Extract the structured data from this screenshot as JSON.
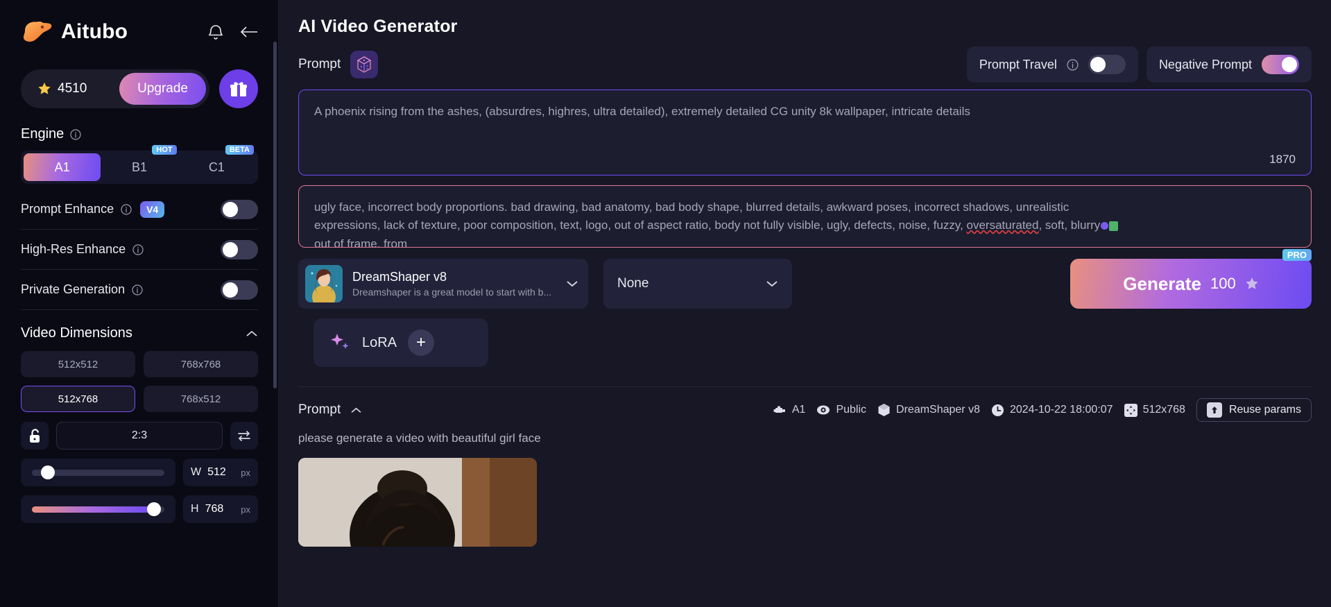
{
  "sidebar": {
    "brand": "Aitubo",
    "icons": {
      "bell": "bell-icon",
      "back": "back-arrow-icon",
      "gift": "gift-icon",
      "star": "star-icon"
    },
    "credits": "4510",
    "upgrade_label": "Upgrade",
    "engine": {
      "title": "Engine",
      "tabs": [
        {
          "label": "A1",
          "tag": "",
          "active": true
        },
        {
          "label": "B1",
          "tag": "HOT",
          "active": false
        },
        {
          "label": "C1",
          "tag": "BETA",
          "active": false
        }
      ]
    },
    "toggles": [
      {
        "label": "Prompt Enhance",
        "badge": "V4",
        "on": false
      },
      {
        "label": "High-Res Enhance",
        "badge": "",
        "on": false
      },
      {
        "label": "Private Generation",
        "badge": "",
        "on": false
      }
    ],
    "dimensions": {
      "title": "Video Dimensions",
      "presets": [
        {
          "label": "512x512",
          "active": false
        },
        {
          "label": "768x768",
          "active": false
        },
        {
          "label": "512x768",
          "active": true
        },
        {
          "label": "768x512",
          "active": false
        }
      ],
      "lock_icon": "unlock-icon",
      "ratio": "2:3",
      "swap_icon": "swap-icon",
      "width": {
        "key": "W",
        "value": "512",
        "unit": "px",
        "percent": 12
      },
      "height": {
        "key": "H",
        "value": "768",
        "unit": "px",
        "percent": 92
      }
    }
  },
  "main": {
    "title": "AI Video Generator",
    "prompt_label": "Prompt",
    "dice_icon": "dice-cube-icon",
    "header_toggles": [
      {
        "label": "Prompt Travel",
        "info": true,
        "on": false
      },
      {
        "label": "Negative Prompt",
        "info": false,
        "on": true
      }
    ],
    "prompt": {
      "value": "A phoenix rising from the ashes, (absurdres, highres, ultra detailed), extremely detailed CG unity 8k wallpaper, intricate details",
      "count": "1870"
    },
    "negative_prompt": {
      "line1": "ugly face, incorrect body proportions. bad drawing, bad anatomy, bad body shape, blurred details, awkward poses, incorrect shadows, unrealistic",
      "line2a": "expressions, lack of texture, poor composition, text, logo, out of aspect ratio, body not fully visible, ugly, defects, noise, fuzzy, ",
      "line2_squiggle": "oversaturated",
      "line2b": ", soft, blurry",
      "line3": "out of frame, from "
    },
    "model": {
      "name": "DreamShaper v8",
      "description": "Dreamshaper is a great model to start with b...",
      "chevron": "chevron-down-icon"
    },
    "lora_select": {
      "value": "None",
      "chevron": "chevron-down-icon"
    },
    "lora_chip": {
      "label": "LoRA",
      "plus": "+",
      "sparkle_icon": "sparkles-icon"
    },
    "generate": {
      "label": "Generate",
      "cost": "100",
      "badge": "PRO",
      "star_icon": "star-icon"
    }
  },
  "result": {
    "prompt_label": "Prompt",
    "collapse_icon": "chevron-up-icon",
    "prompt_text": "please generate a video with beautiful girl face",
    "meta": [
      {
        "icon": "engine-icon",
        "label": "A1"
      },
      {
        "icon": "eye-icon",
        "label": "Public"
      },
      {
        "icon": "cube-icon",
        "label": "DreamShaper v8"
      },
      {
        "icon": "clock-icon",
        "label": "2024-10-22 18:00:07"
      },
      {
        "icon": "resize-icon",
        "label": "512x768"
      }
    ],
    "reuse_label": "Reuse params",
    "reuse_icon": "upload-icon"
  },
  "colors": {
    "accent_purple": "#6d4bf2",
    "accent_pink": "#e8907f",
    "sidebar_bg": "#0a0a14",
    "main_bg": "#171726",
    "panel_bg": "#22223a",
    "negative_border": "#e0788f"
  }
}
